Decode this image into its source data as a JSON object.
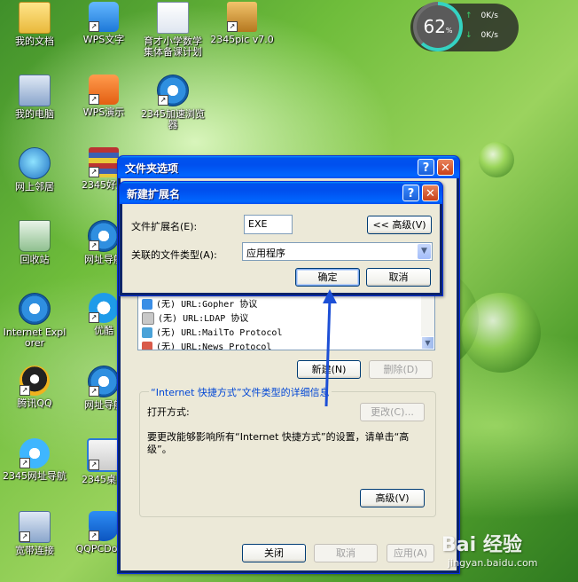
{
  "desktop": {
    "icons": [
      {
        "label": "我的文档",
        "icon": "my-documents-icon"
      },
      {
        "label": "WPS文字",
        "icon": "wps-writer-icon"
      },
      {
        "label": "育才小学数学集体备课计划",
        "icon": "word-document-icon"
      },
      {
        "label": "2345pic v7.0",
        "icon": "2345pic-icon"
      },
      {
        "label": "我的电脑",
        "icon": "my-computer-icon"
      },
      {
        "label": "WPS演示",
        "icon": "wps-presentation-icon"
      },
      {
        "label": "2345加速浏览器",
        "icon": "2345-browser-icon"
      },
      {
        "label": "网上邻居",
        "icon": "network-places-icon"
      },
      {
        "label": "2345好压",
        "icon": "2345-haozip-icon"
      },
      {
        "label": "回收站",
        "icon": "recycle-bin-icon"
      },
      {
        "label": "网址导航",
        "icon": "url-navigation-icon"
      },
      {
        "label": "Internet Explorer",
        "icon": "internet-explorer-icon"
      },
      {
        "label": "优酷",
        "icon": "youku-icon"
      },
      {
        "label": "腾讯QQ",
        "icon": "tencent-qq-icon"
      },
      {
        "label": "网址导航",
        "icon": "url-navigation-icon"
      },
      {
        "label": "2345网址导航",
        "icon": "2345-navigation-icon"
      },
      {
        "label": "2345桌面",
        "icon": "2345-desktop-icon"
      },
      {
        "label": "宽带连接",
        "icon": "broadband-connection-icon"
      },
      {
        "label": "QQPCDown",
        "icon": "qq-pc-manager-icon"
      }
    ]
  },
  "widget": {
    "percent": "62",
    "percent_unit": "%",
    "upload": "0K/s",
    "download": "0K/s",
    "upload_arrow": "↑",
    "download_arrow": "↓"
  },
  "folder_options": {
    "title": "文件夹选项",
    "help_glyph": "?",
    "close_glyph": "✕",
    "list_rows": [
      {
        "ext": "(无)",
        "type": "URL:Gopher 协议"
      },
      {
        "ext": "(无)",
        "type": "URL:LDAP 协议"
      },
      {
        "ext": "(无)",
        "type": "URL:MailTo Protocol"
      },
      {
        "ext": "(无)",
        "type": "URL:News Protocol"
      }
    ],
    "new_button": "新建(N)",
    "delete_button": "删除(D)",
    "details_title": "“Internet 快捷方式”文件类型的详细信息",
    "opens_with_label": "打开方式:",
    "change_button": "更改(C)...",
    "description": "要更改能够影响所有“Internet 快捷方式”的设置，请单击“高级”。",
    "advanced_button": "高级(V)",
    "close_button": "关闭",
    "cancel_button": "取消",
    "apply_button": "应用(A)"
  },
  "new_extension": {
    "title": "新建扩展名",
    "help_glyph": "?",
    "close_glyph": "✕",
    "ext_label": "文件扩展名(E):",
    "ext_value": "EXE",
    "advanced_toggle": "<< 高级(V)",
    "assoc_label": "关联的文件类型(A):",
    "assoc_value": "应用程序",
    "ok_button": "确定",
    "cancel_button": "取消"
  },
  "watermark": {
    "brand": "Bai 经验",
    "url": "jingyan.baidu.com"
  }
}
